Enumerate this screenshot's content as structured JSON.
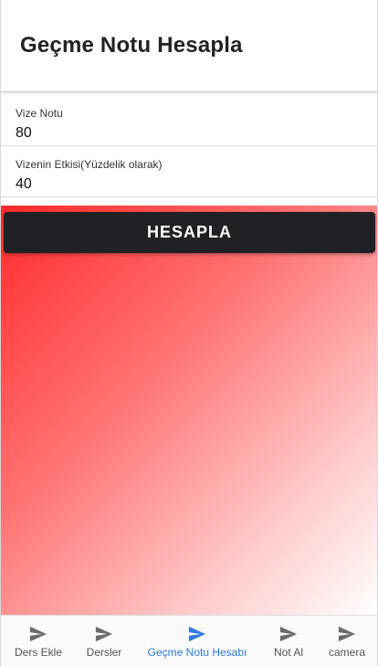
{
  "header": {
    "title": "Geçme Notu Hesapla"
  },
  "form": {
    "fields": [
      {
        "label": "Vize Notu",
        "value": "80"
      },
      {
        "label": "Vizenin Etkisi(Yüzdelik olarak)",
        "value": "40"
      }
    ],
    "button_label": "HESAPLA"
  },
  "tabbar": {
    "tabs": [
      {
        "label": "Ders Ekle",
        "icon": "send-icon",
        "active": false
      },
      {
        "label": "Dersler",
        "icon": "send-icon",
        "active": false
      },
      {
        "label": "Geçme Notu Hesabı",
        "icon": "send-icon",
        "active": true
      },
      {
        "label": "Not Al",
        "icon": "send-icon",
        "active": false
      },
      {
        "label": "camera",
        "icon": "send-icon",
        "active": false
      }
    ]
  },
  "colors": {
    "accent": "#2f7ae5",
    "button_bg": "#202124",
    "gradient_start": "#ff2a2a",
    "gradient_end": "#ffffff"
  }
}
